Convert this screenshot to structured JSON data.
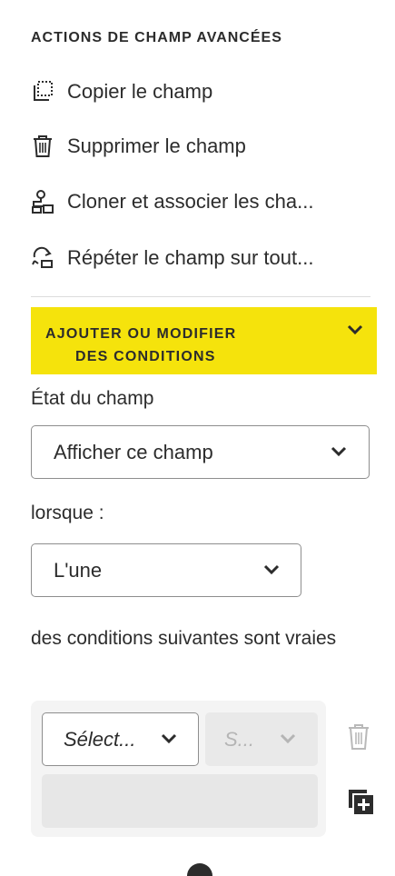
{
  "advanced_actions": {
    "title": "ACTIONS DE CHAMP AVANCÉES",
    "items": [
      {
        "label": "Copier le champ",
        "icon": "copy-field-icon"
      },
      {
        "label": "Supprimer le champ",
        "icon": "trash-icon"
      },
      {
        "label": "Cloner et associer les cha...",
        "icon": "clone-link-icon"
      },
      {
        "label": "Répéter le champ sur tout...",
        "icon": "repeat-field-icon"
      }
    ]
  },
  "conditions": {
    "header_line1": "AJOUTER OU MODIFIER",
    "header_line2": "DES CONDITIONS",
    "accent_color": "#f5e30c",
    "field_state_label": "État du champ",
    "field_state_value": "Afficher ce champ",
    "when_label": "lorsque :",
    "when_value": "L'une",
    "conditions_text": "des conditions suivantes sont vraies",
    "rule": {
      "field_value": "Sélect...",
      "operator_value": "S..."
    }
  }
}
